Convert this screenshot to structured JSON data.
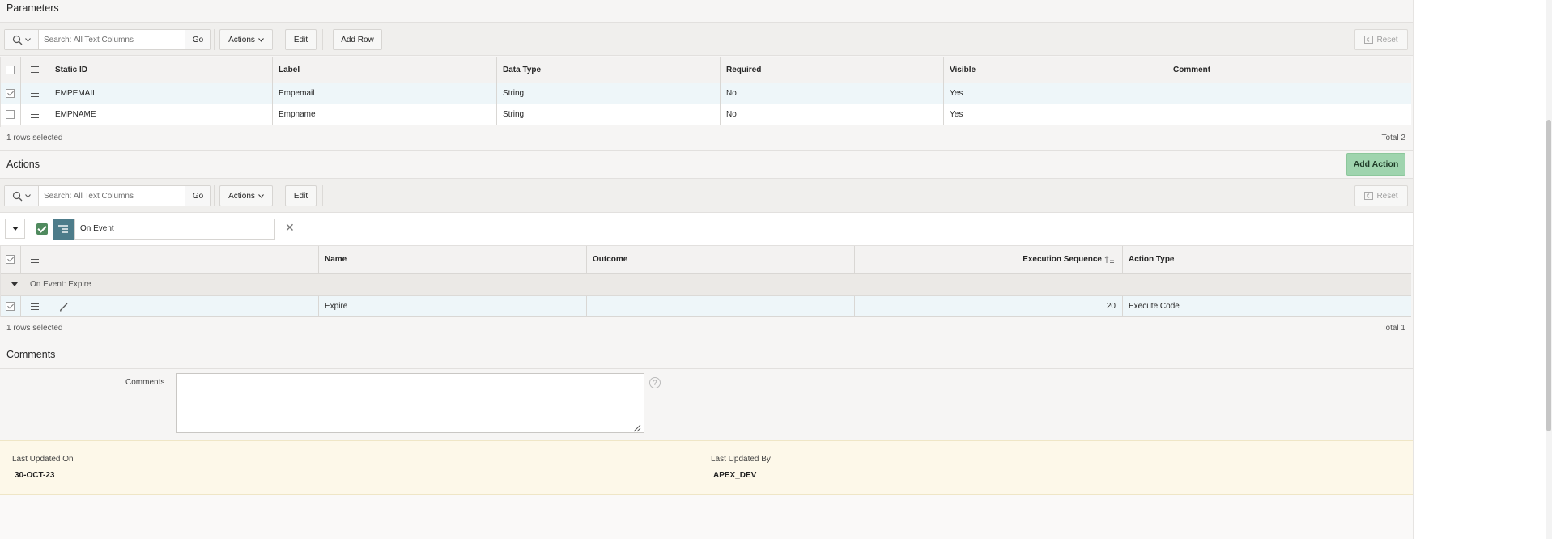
{
  "parameters": {
    "title": "Parameters",
    "search_placeholder": "Search: All Text Columns",
    "go_label": "Go",
    "actions_label": "Actions",
    "edit_label": "Edit",
    "add_row_label": "Add Row",
    "reset_label": "Reset",
    "columns": [
      "Static ID",
      "Label",
      "Data Type",
      "Required",
      "Visible",
      "Comment"
    ],
    "rows": [
      {
        "static_id": "EMPEMAIL",
        "label": "Empemail",
        "data_type": "String",
        "required": "No",
        "visible": "Yes",
        "comment": "",
        "selected": true
      },
      {
        "static_id": "EMPNAME",
        "label": "Empname",
        "data_type": "String",
        "required": "No",
        "visible": "Yes",
        "comment": "",
        "selected": false
      }
    ],
    "footer_left": "1 rows selected",
    "footer_right": "Total 2"
  },
  "actions": {
    "title": "Actions",
    "add_action_label": "Add Action",
    "search_placeholder": "Search: All Text Columns",
    "go_label": "Go",
    "actions_label": "Actions",
    "edit_label": "Edit",
    "reset_label": "Reset",
    "control_break_value": "On Event",
    "columns": [
      "Name",
      "Outcome",
      "Execution Sequence",
      "Action Type"
    ],
    "group_label": "On Event: Expire",
    "rows": [
      {
        "name": "Expire",
        "outcome": "",
        "execution_sequence": "20",
        "action_type": "Execute Code",
        "selected": true
      }
    ],
    "footer_left": "1 rows selected",
    "footer_right": "Total 1"
  },
  "comments": {
    "title": "Comments",
    "field_label": "Comments",
    "value": ""
  },
  "audit": {
    "last_updated_on_label": "Last Updated On",
    "last_updated_on": "30-OCT-23",
    "last_updated_by_label": "Last Updated By",
    "last_updated_by": "APEX_DEV"
  },
  "colors": {
    "add_action_bg": "#9fd4ae",
    "selected_row_bg": "#eef6f9",
    "audit_bg": "#fdf8e9",
    "control_break_icon": "#4d7c8a",
    "check_green": "#4f8a5e"
  }
}
